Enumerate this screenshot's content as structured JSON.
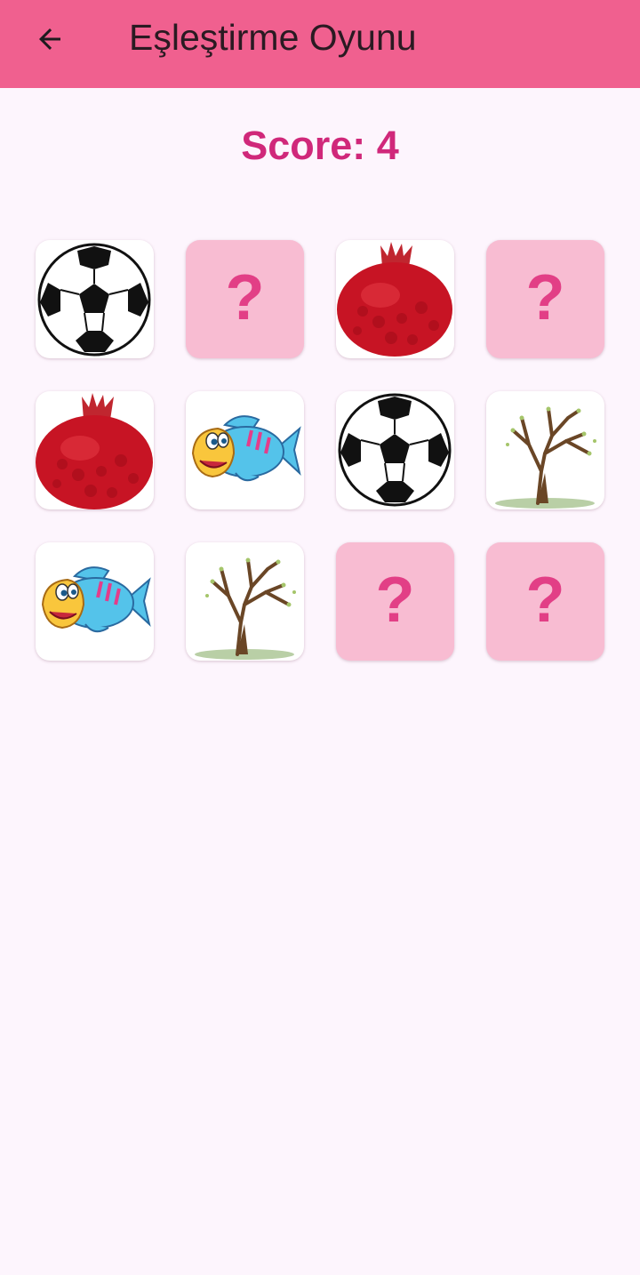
{
  "app_bar": {
    "title": "Eşleştirme Oyunu",
    "back_icon": "arrow-back-icon",
    "color": "#f0608f"
  },
  "score": {
    "label": "Score:",
    "value": "4"
  },
  "board": {
    "rows": 3,
    "columns": 4,
    "cards": [
      {
        "state": "open",
        "image": "soccer-ball"
      },
      {
        "state": "closed",
        "symbol": "?"
      },
      {
        "state": "open",
        "image": "pomegranate"
      },
      {
        "state": "closed",
        "symbol": "?"
      },
      {
        "state": "open",
        "image": "pomegranate"
      },
      {
        "state": "open",
        "image": "fish"
      },
      {
        "state": "open",
        "image": "soccer-ball"
      },
      {
        "state": "open",
        "image": "tree"
      },
      {
        "state": "open",
        "image": "fish"
      },
      {
        "state": "open",
        "image": "tree"
      },
      {
        "state": "closed",
        "symbol": "?"
      },
      {
        "state": "closed",
        "symbol": "?"
      }
    ]
  },
  "colors": {
    "background": "#fdf5fd",
    "card_back": "#f8bcd2",
    "question_mark": "#e23f86",
    "score_text": "#d0287a"
  }
}
